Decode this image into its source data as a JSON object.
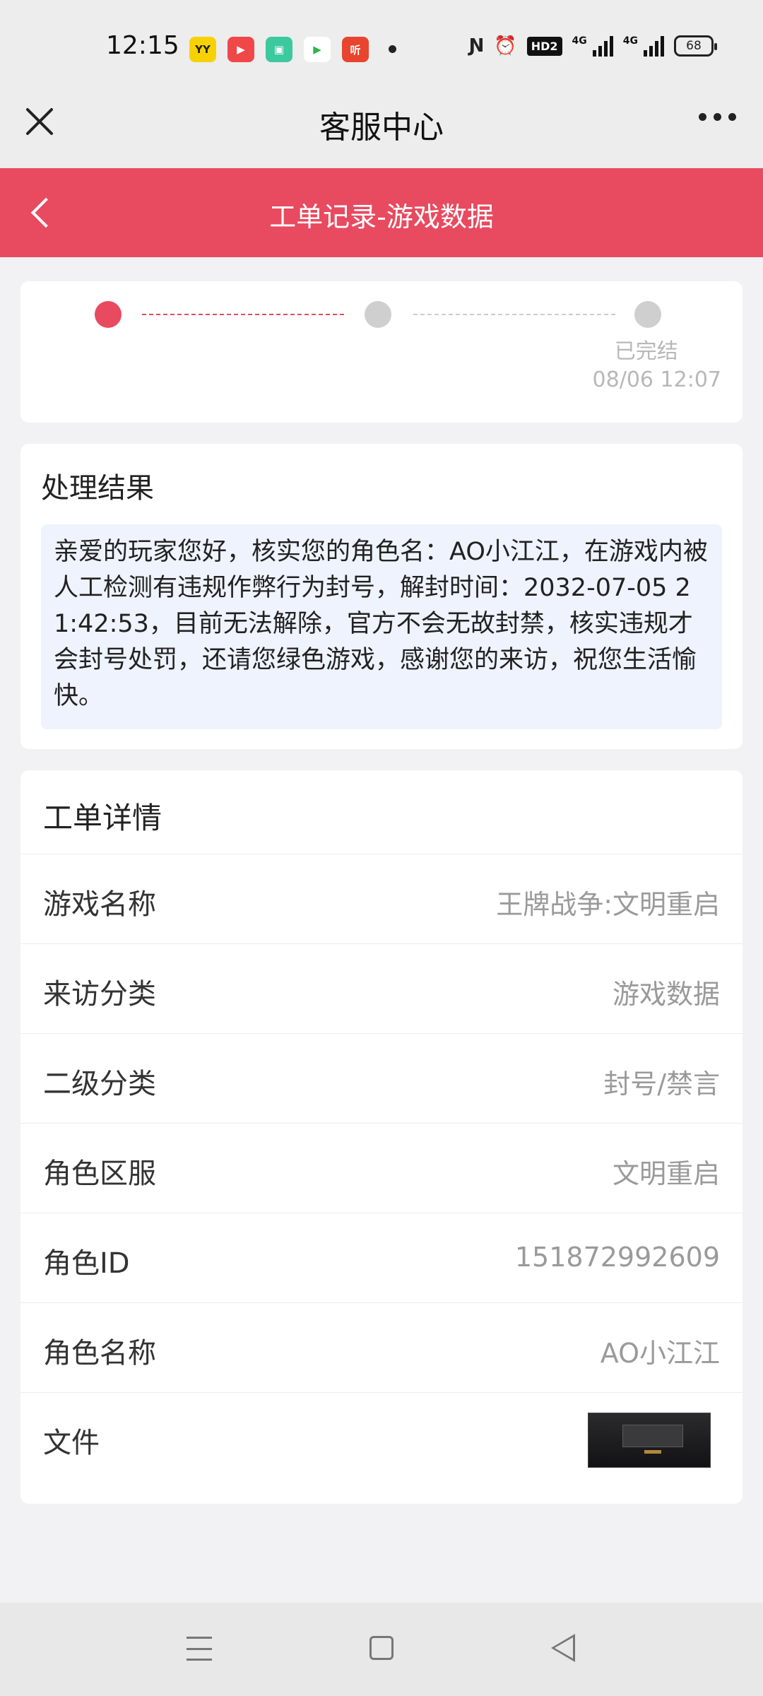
{
  "status_bar": {
    "time": "12:15",
    "apps": [
      {
        "name": "yy-app-icon",
        "label": "YY",
        "color": "#f7d200",
        "text_color": "#222"
      },
      {
        "name": "video-app-icon",
        "label": "▶",
        "color": "#f04848",
        "text_color": "#fff"
      },
      {
        "name": "gallery-app-icon",
        "label": "▣",
        "color": "#3cc9a0",
        "text_color": "#fff"
      },
      {
        "name": "tencent-video-icon",
        "label": "▶",
        "color": "#ffffff",
        "text_color": "#2bb64b"
      },
      {
        "name": "listen-app-icon",
        "label": "听",
        "color": "#e8442e",
        "text_color": "#fff"
      }
    ],
    "hd_label": "HD2",
    "network_1": "4G",
    "network_2": "4G",
    "battery": "68"
  },
  "titlebar": {
    "title": "客服中心"
  },
  "header": {
    "title": "工单记录-游戏数据"
  },
  "progress": {
    "final_step_label": "已完结",
    "final_step_time": "08/06 12:07"
  },
  "result": {
    "title": "处理结果",
    "text": "亲爱的玩家您好，核实您的角色名：AO小江江，在游戏内被人工检测有违规作弊行为封号，解封时间：2032-07-05 21:42:53，目前无法解除，官方不会无故封禁，核实违规才会封号处罚，还请您绿色游戏，感谢您的来访，祝您生活愉快。"
  },
  "details": {
    "title": "工单详情",
    "rows": [
      {
        "label": "游戏名称",
        "value": "王牌战争:文明重启"
      },
      {
        "label": "来访分类",
        "value": "游戏数据"
      },
      {
        "label": "二级分类",
        "value": "封号/禁言"
      },
      {
        "label": "角色区服",
        "value": "文明重启"
      },
      {
        "label": "角色ID",
        "value": "151872992609"
      },
      {
        "label": "角色名称",
        "value": "AO小江江"
      },
      {
        "label": "文件",
        "value": ""
      }
    ]
  }
}
